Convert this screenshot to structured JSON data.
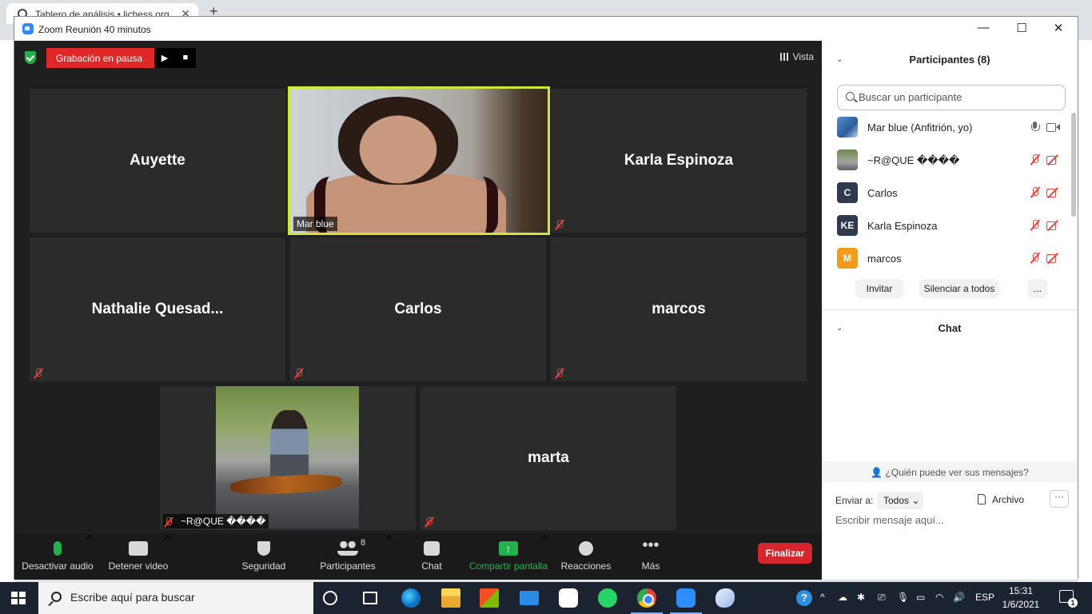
{
  "browser": {
    "tab_title": "Tablero de análisis • lichess.org",
    "tab_close": "✕",
    "new_tab": "+",
    "window_controls": [
      "–",
      "❐",
      "✕"
    ]
  },
  "window": {
    "title": "Zoom Reunión 40 minutos",
    "minimize": "—",
    "maximize": "☐",
    "close": "✕"
  },
  "recording": {
    "label": "Grabación en pausa",
    "play": "▶",
    "stop": "■"
  },
  "view": {
    "label": "Vista"
  },
  "tiles": [
    {
      "name": "Auyette",
      "muted": false
    },
    {
      "name": "Mar blue",
      "muted": false,
      "video": true,
      "active": true
    },
    {
      "name": "Karla Espinoza",
      "muted": true
    },
    {
      "name": "Nathalie  Quesad...",
      "muted": true
    },
    {
      "name": "Carlos",
      "muted": true
    },
    {
      "name": "marcos",
      "muted": true
    },
    {
      "name": "~R@QUE ����",
      "muted": true,
      "video": true
    },
    {
      "name": "marta",
      "muted": true
    }
  ],
  "toolbar": {
    "audio": "Desactivar audio",
    "video": "Detener video",
    "security": "Seguridad",
    "participants": "Participantes",
    "participants_count": "8",
    "chat": "Chat",
    "share": "Compartir pantalla",
    "reactions": "Reacciones",
    "more": "Más",
    "end": "Finalizar",
    "caret": "^"
  },
  "participants_panel": {
    "title": "Participantes (8)",
    "caret": "⌄",
    "search_placeholder": "Buscar un participante",
    "items": [
      {
        "name": "Mar blue (Anfitrión, yo)",
        "avatar": "",
        "avatar_type": "image",
        "mic": "on",
        "cam": "on"
      },
      {
        "name": "~R@QUE ����",
        "avatar": "",
        "avatar_type": "image",
        "mic": "off",
        "cam": "off"
      },
      {
        "name": "Carlos",
        "avatar": "C",
        "avatar_color": "#2f3a4f",
        "mic": "off",
        "cam": "off"
      },
      {
        "name": "Karla Espinoza",
        "avatar": "KE",
        "avatar_color": "#2f3a4f",
        "mic": "off",
        "cam": "off"
      },
      {
        "name": "marcos",
        "avatar": "M",
        "avatar_color": "#f29a1b",
        "mic": "off",
        "cam": "off"
      }
    ],
    "invite": "Invitar",
    "mute_all": "Silenciar a todos",
    "more": "..."
  },
  "chat_panel": {
    "title": "Chat",
    "who_can_see": "¿Quién puede ver sus mensajes?",
    "send_to_label": "Enviar a:",
    "send_to_value": "Todos",
    "file": "Archivo",
    "more": "···",
    "input_placeholder": "Escribir mensaje aquí..."
  },
  "taskbar": {
    "search_placeholder": "Escribe aquí para buscar",
    "help": "?",
    "language": "ESP",
    "time": "15:31",
    "date": "1/6/2021",
    "notification_count": "1",
    "tray_chevron": "^"
  }
}
